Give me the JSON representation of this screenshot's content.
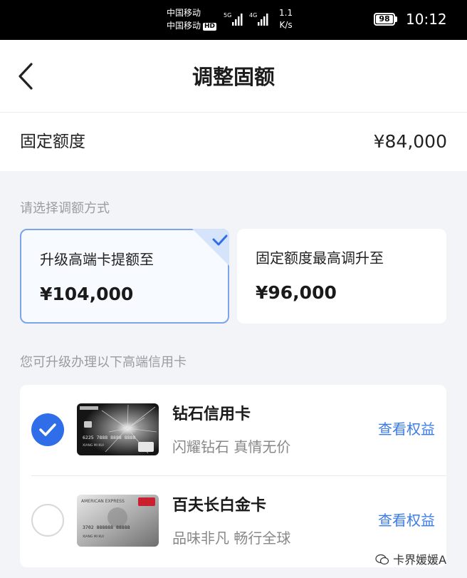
{
  "status_bar": {
    "carrier1": "中国移动",
    "carrier2": "中国移动",
    "hd_badge": "HD",
    "net1": "5G",
    "net2": "4G",
    "speed_value": "1.1",
    "speed_unit": "K/s",
    "battery": "98",
    "time": "10:12"
  },
  "nav": {
    "title": "调整固额",
    "back_icon": "chevron-left-icon"
  },
  "fixed": {
    "label": "固定额度",
    "value": "¥84,000"
  },
  "method": {
    "hint": "请选择调额方式",
    "options": [
      {
        "title": "升级高端卡提额至",
        "amount": "¥104,000",
        "selected": true
      },
      {
        "title": "固定额度最高调升至",
        "amount": "¥96,000",
        "selected": false
      }
    ]
  },
  "cards": {
    "hint": "您可升级办理以下高端信用卡",
    "items": [
      {
        "name": "钻石信用卡",
        "slogan": "闪耀钻石 真情无价",
        "link": "查看权益",
        "selected": true,
        "card_number": "6225 7888 8888 8888",
        "holder": "XIANG MI KUI"
      },
      {
        "name": "百夫长白金卡",
        "slogan": "品味非凡 畅行全球",
        "link": "查看权益",
        "selected": false,
        "card_number": "3702 888888 88888",
        "holder": "XIANG MI KUI",
        "brand": "AMERICAN EXPRESS"
      }
    ]
  },
  "watermark": "卡界媛媛A",
  "colors": {
    "accent": "#2f6ee8",
    "link": "#3c7be6",
    "selected_border": "#7ca4ea",
    "background": "#f3f4f8"
  }
}
